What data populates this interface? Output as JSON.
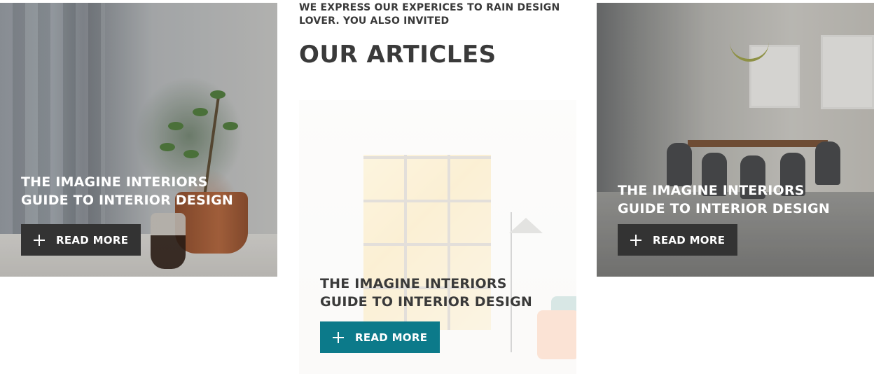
{
  "section": {
    "intro": "WE EXPRESS OUR EXPERICES TO RAIN DESIGN\nLOVER. YOU ALSO INVITED",
    "heading": "OUR ARTICLES"
  },
  "articles": [
    {
      "title": "THE IMAGINE INTERIORS\nGUIDE TO INTERIOR DESIGN",
      "button_label": "READ MORE",
      "button_icon": "plus-icon",
      "image": "plant-on-windowsill-photo",
      "button_color": "#333333"
    },
    {
      "title": "THE IMAGINE INTERIORS\nGUIDE TO INTERIOR DESIGN",
      "button_label": "READ MORE",
      "button_icon": "plus-icon",
      "image": "living-room-window-photo",
      "button_color": "#0c7a8a"
    },
    {
      "title": "THE IMAGINE INTERIORS\nGUIDE TO INTERIOR DESIGN",
      "button_label": "READ MORE",
      "button_icon": "plus-icon",
      "image": "dining-room-photo",
      "button_color": "#333333"
    }
  ],
  "colors": {
    "text": "#3a3a3a",
    "accent": "#0c7a8a",
    "dark_button": "#333333"
  }
}
